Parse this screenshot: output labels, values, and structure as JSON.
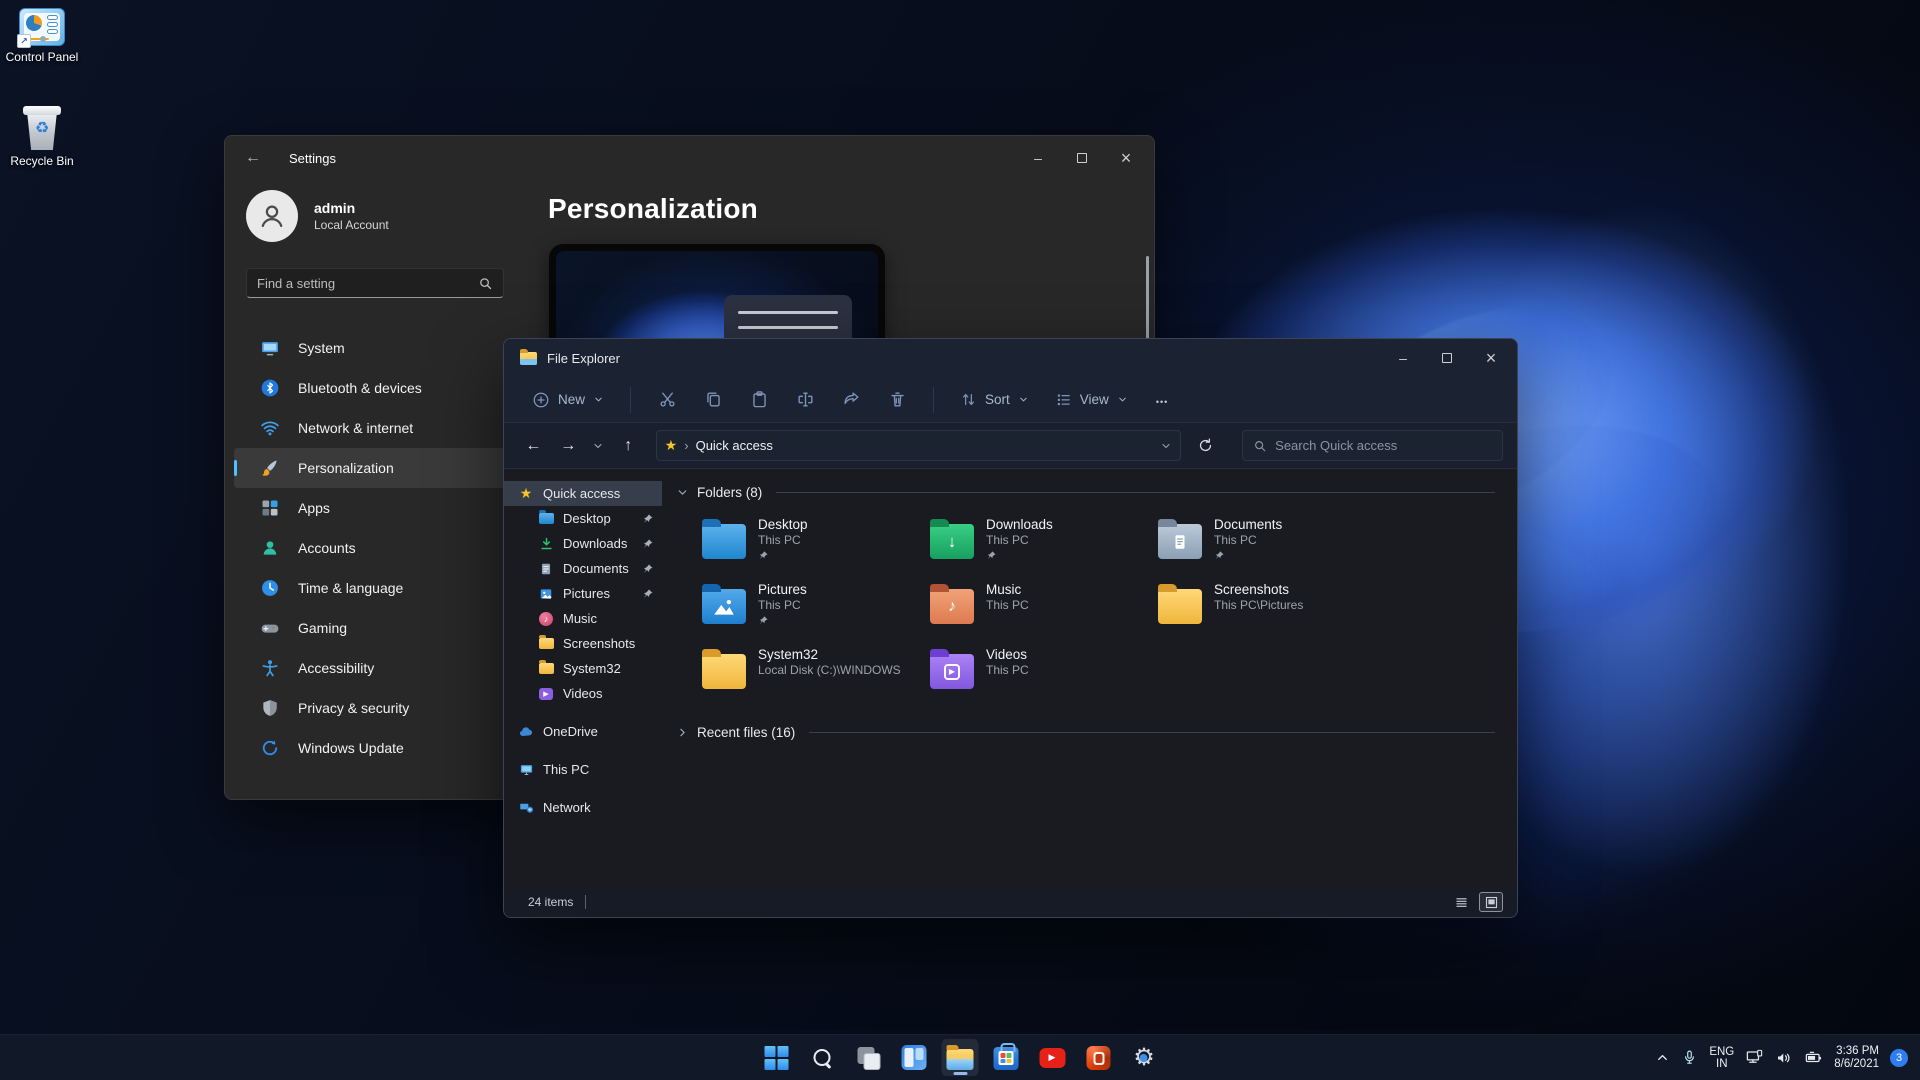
{
  "desktop": {
    "icons": [
      {
        "label": "Control Panel",
        "icon": "control-panel-icon"
      },
      {
        "label": "Recycle Bin",
        "icon": "recycle-bin-icon"
      }
    ]
  },
  "settings": {
    "window_title": "Settings",
    "user": {
      "name": "admin",
      "account_type": "Local Account"
    },
    "search": {
      "placeholder": "Find a setting"
    },
    "nav": [
      {
        "label": "System",
        "icon": "system-icon",
        "selected": false
      },
      {
        "label": "Bluetooth & devices",
        "icon": "bluetooth-icon",
        "selected": false
      },
      {
        "label": "Network & internet",
        "icon": "network-icon",
        "selected": false
      },
      {
        "label": "Personalization",
        "icon": "personalization-icon",
        "selected": true
      },
      {
        "label": "Apps",
        "icon": "apps-icon",
        "selected": false
      },
      {
        "label": "Accounts",
        "icon": "accounts-icon",
        "selected": false
      },
      {
        "label": "Time & language",
        "icon": "time-language-icon",
        "selected": false
      },
      {
        "label": "Gaming",
        "icon": "gaming-icon",
        "selected": false
      },
      {
        "label": "Accessibility",
        "icon": "accessibility-icon",
        "selected": false
      },
      {
        "label": "Privacy & security",
        "icon": "privacy-security-icon",
        "selected": false
      },
      {
        "label": "Windows Update",
        "icon": "windows-update-icon",
        "selected": false
      }
    ],
    "page_title": "Personalization"
  },
  "explorer": {
    "window_title": "File Explorer",
    "toolbar": {
      "new_label": "New",
      "sort_label": "Sort",
      "view_label": "View"
    },
    "address": {
      "location": "Quick access",
      "search_placeholder": "Search Quick access"
    },
    "nav": [
      {
        "label": "Quick access",
        "icon": "star-icon",
        "selected": true
      },
      {
        "label": "Desktop",
        "icon": "desktop-folder-icon",
        "pinned": true
      },
      {
        "label": "Downloads",
        "icon": "downloads-icon",
        "pinned": true
      },
      {
        "label": "Documents",
        "icon": "documents-icon",
        "pinned": true
      },
      {
        "label": "Pictures",
        "icon": "pictures-icon",
        "pinned": true
      },
      {
        "label": "Music",
        "icon": "music-icon",
        "pinned": false
      },
      {
        "label": "Screenshots",
        "icon": "folder-icon",
        "pinned": false
      },
      {
        "label": "System32",
        "icon": "folder-icon",
        "pinned": false
      },
      {
        "label": "Videos",
        "icon": "videos-icon",
        "pinned": false
      },
      {
        "label": "OneDrive",
        "icon": "onedrive-cloud-icon",
        "pinned": false
      },
      {
        "label": "This PC",
        "icon": "this-pc-icon",
        "pinned": false
      },
      {
        "label": "Network",
        "icon": "network-pc-icon",
        "pinned": false
      }
    ],
    "sections": {
      "folders": "Folders (8)",
      "recent": "Recent files (16)"
    },
    "folders": [
      {
        "name": "Desktop",
        "location": "This PC",
        "pinned": true,
        "icon": "desktop-folder-icon"
      },
      {
        "name": "Downloads",
        "location": "This PC",
        "pinned": true,
        "icon": "downloads-folder-icon"
      },
      {
        "name": "Documents",
        "location": "This PC",
        "pinned": true,
        "icon": "documents-folder-icon"
      },
      {
        "name": "Pictures",
        "location": "This PC",
        "pinned": true,
        "icon": "pictures-folder-icon"
      },
      {
        "name": "Music",
        "location": "This PC",
        "pinned": false,
        "icon": "music-folder-icon"
      },
      {
        "name": "Screenshots",
        "location": "This PC\\Pictures",
        "pinned": false,
        "icon": "yellow-folder-icon"
      },
      {
        "name": "System32",
        "location": "Local Disk (C:)\\WINDOWS",
        "pinned": false,
        "icon": "yellow-folder-icon"
      },
      {
        "name": "Videos",
        "location": "This PC",
        "pinned": false,
        "icon": "videos-folder-icon"
      }
    ],
    "status": {
      "item_count": "24 items"
    }
  },
  "taskbar": {
    "buttons": [
      {
        "name": "start",
        "icon": "windows-start-icon"
      },
      {
        "name": "search",
        "icon": "search-icon"
      },
      {
        "name": "task-view",
        "icon": "task-view-icon"
      },
      {
        "name": "widgets",
        "icon": "widgets-icon"
      },
      {
        "name": "file-explorer",
        "icon": "file-explorer-icon",
        "active": true
      },
      {
        "name": "microsoft-store",
        "icon": "microsoft-store-icon"
      },
      {
        "name": "youtube",
        "icon": "youtube-icon"
      },
      {
        "name": "office",
        "icon": "office-icon"
      },
      {
        "name": "settings",
        "icon": "settings-gear-icon"
      }
    ],
    "tray": {
      "language_line1": "ENG",
      "language_line2": "IN",
      "time": "3:36 PM",
      "date": "8/6/2021",
      "notification_count": "3"
    }
  },
  "colors": {
    "accent": "#4cc2ff",
    "selection_bg": "#373737",
    "explorer_chrome": "#1b2232",
    "folder_yellow": "#f2bc4a",
    "badge_blue": "#2f7df0"
  }
}
